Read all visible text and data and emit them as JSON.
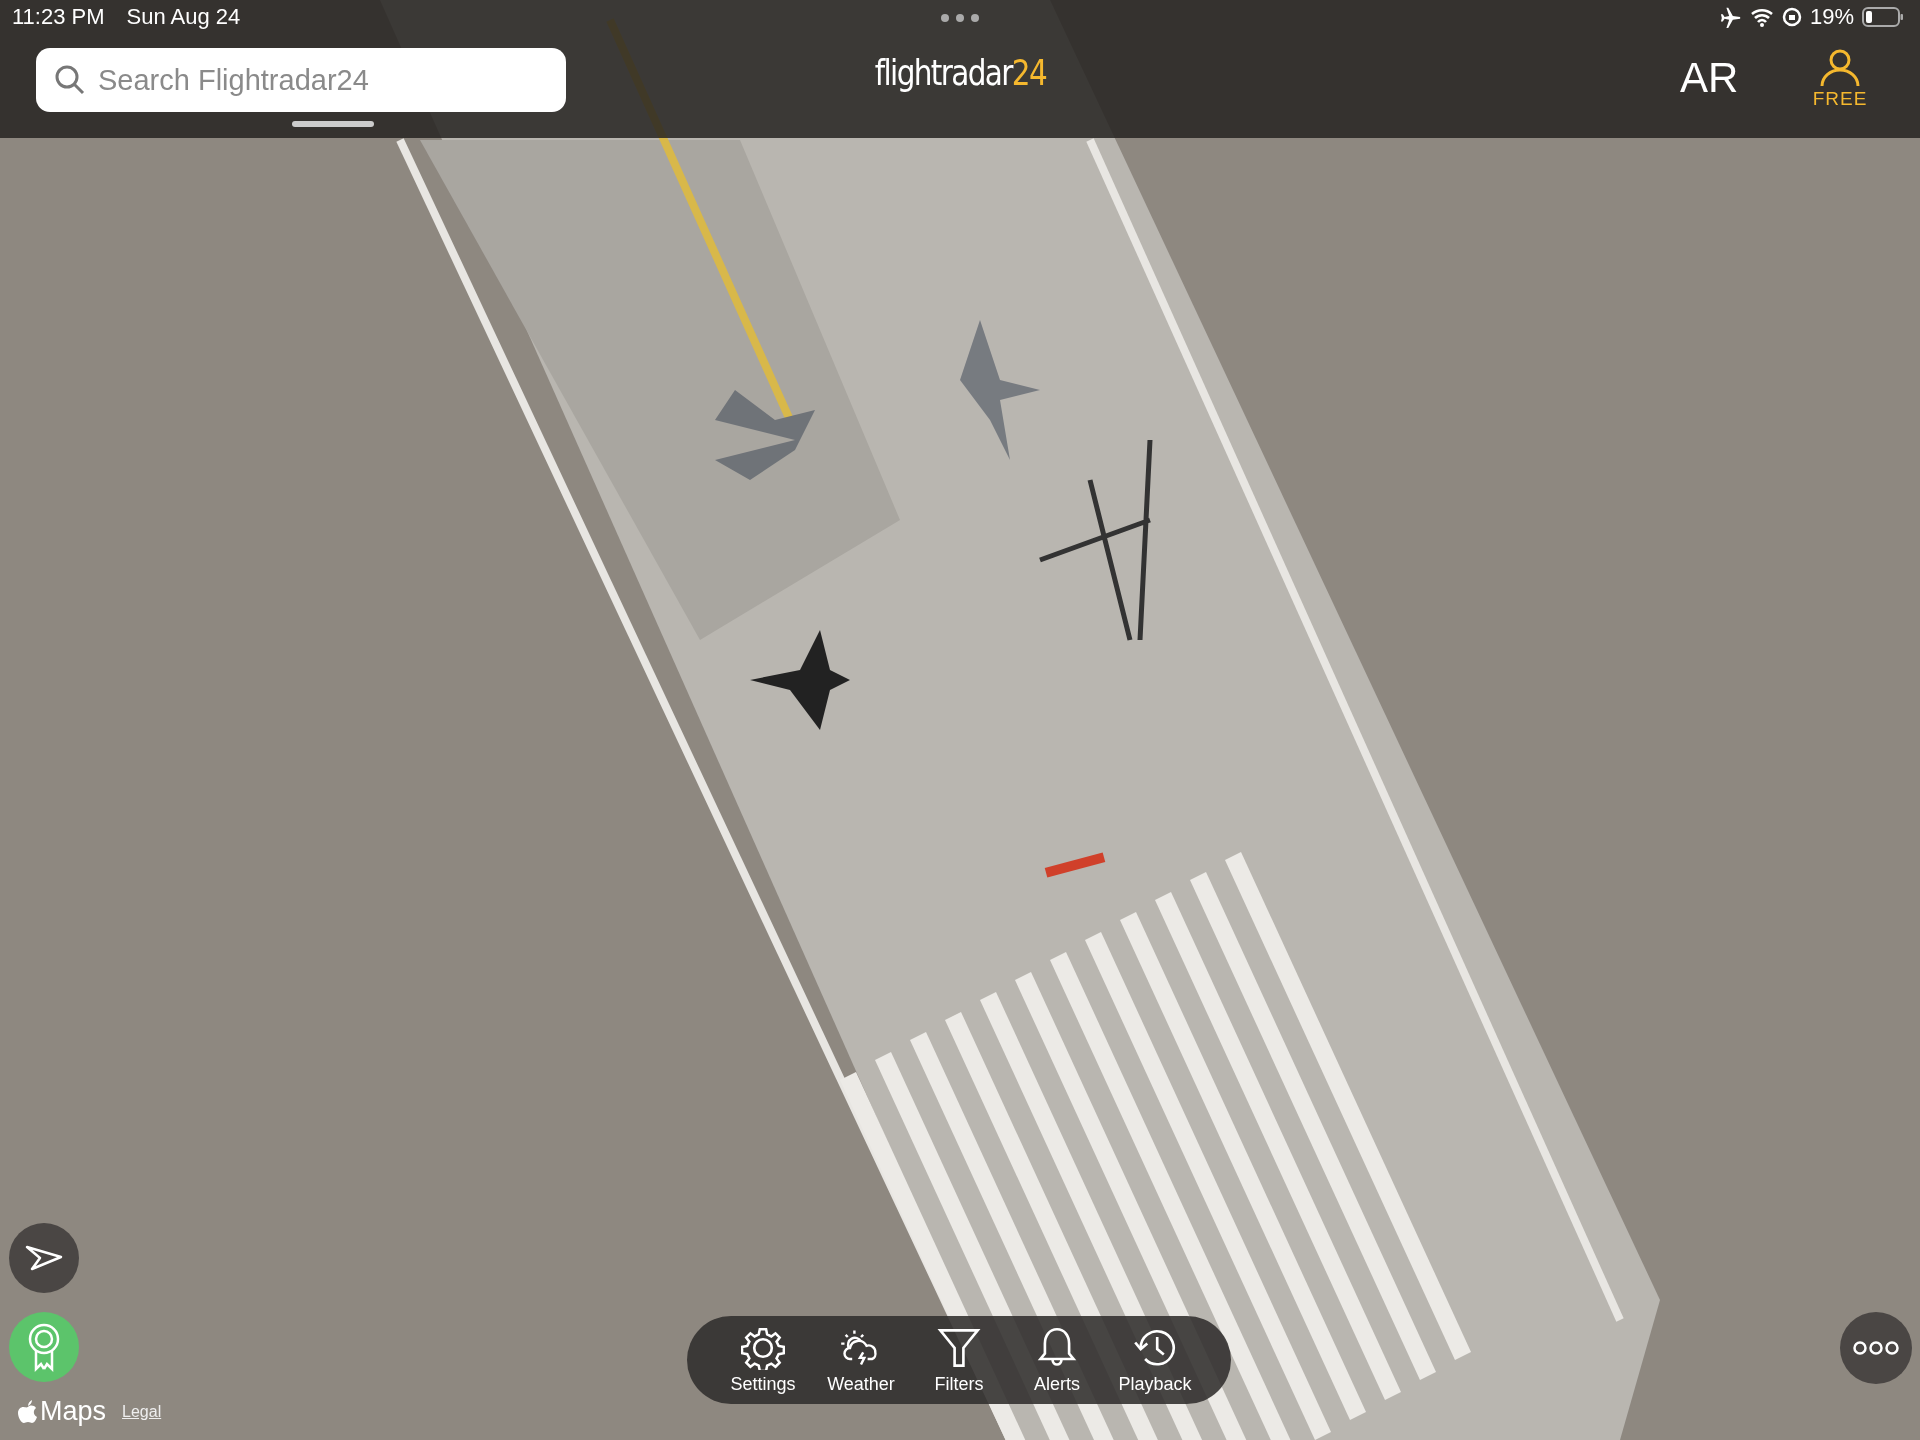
{
  "status_bar": {
    "time": "11:23 PM",
    "date": "Sun Aug 24",
    "battery": "19%"
  },
  "header": {
    "search": {
      "placeholder": "Search Flightradar24"
    },
    "logo": {
      "name": "flightradar",
      "suffix": "24"
    },
    "ar_button": "AR",
    "account": {
      "label": "FREE"
    }
  },
  "toolbar": [
    {
      "kind": "settings",
      "label": "Settings"
    },
    {
      "kind": "weather",
      "label": "Weather"
    },
    {
      "kind": "filters",
      "label": "Filters"
    },
    {
      "kind": "alerts",
      "label": "Alerts"
    },
    {
      "kind": "playback",
      "label": "Playback"
    }
  ],
  "attribution": {
    "brand": "Maps",
    "legal": "Legal"
  }
}
